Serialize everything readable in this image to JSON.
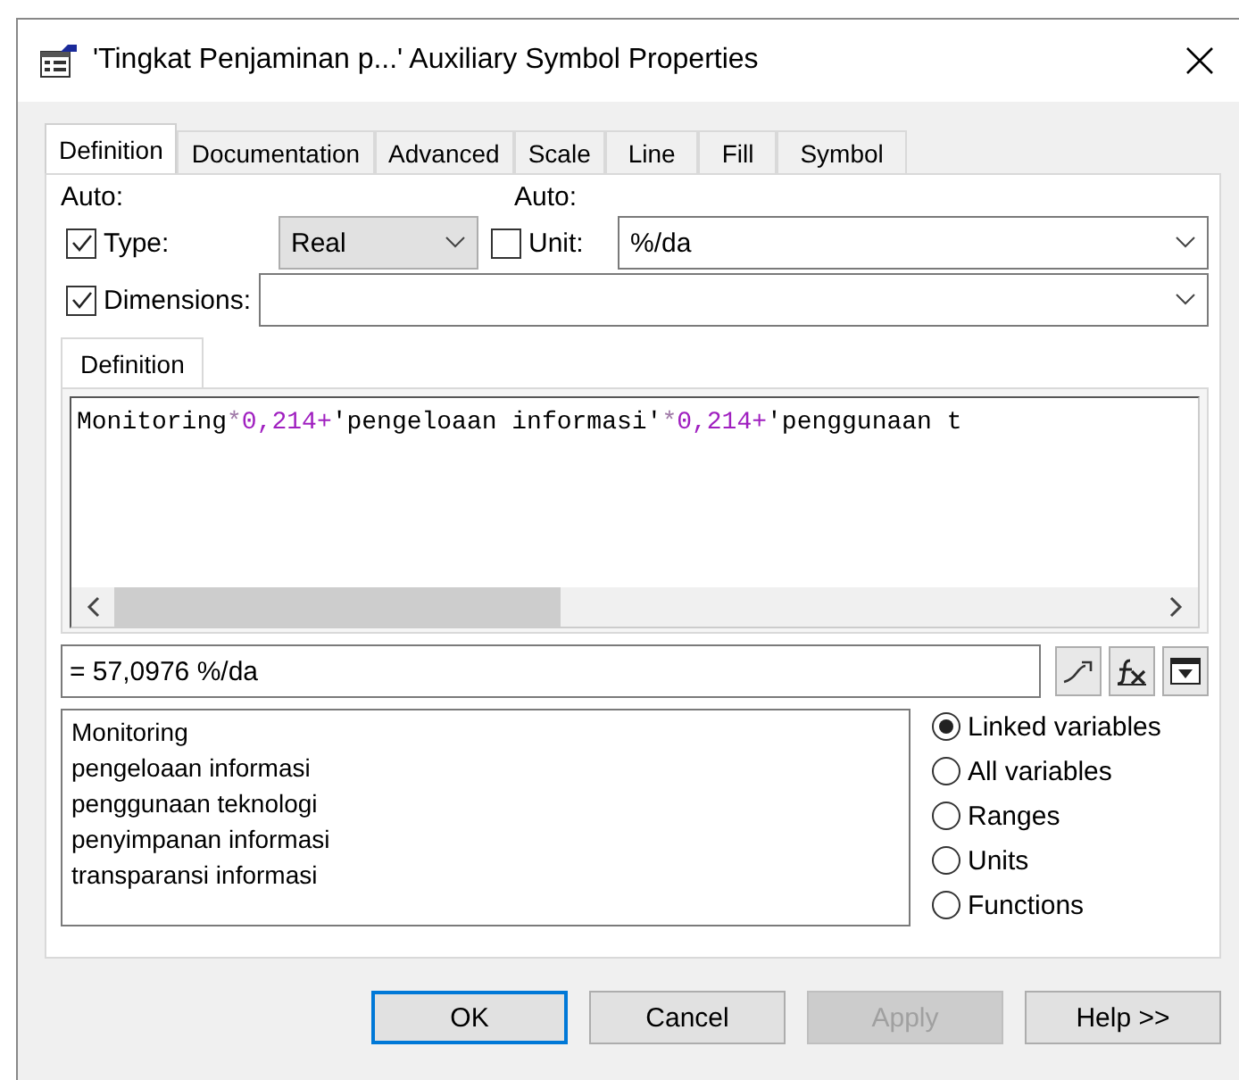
{
  "window": {
    "title": "'Tingkat Penjaminan p...' Auxiliary Symbol Properties"
  },
  "tabs": [
    {
      "label": "Definition",
      "selected": true
    },
    {
      "label": "Documentation",
      "selected": false
    },
    {
      "label": "Advanced",
      "selected": false
    },
    {
      "label": "Scale",
      "selected": false
    },
    {
      "label": "Line",
      "selected": false
    },
    {
      "label": "Fill",
      "selected": false
    },
    {
      "label": "Symbol",
      "selected": false
    }
  ],
  "type_row": {
    "auto_label": "Auto:",
    "label": "Type:",
    "checked": true,
    "value": "Real"
  },
  "unit_row": {
    "auto_label": "Auto:",
    "label": "Unit:",
    "checked": false,
    "value": "%/da"
  },
  "dimensions_row": {
    "label": "Dimensions:",
    "checked": true
  },
  "definition": {
    "tab": "Definition",
    "tokens": [
      {
        "kind": "name",
        "text": "Monitoring"
      },
      {
        "kind": "op",
        "text": "*"
      },
      {
        "kind": "num",
        "text": "0,214"
      },
      {
        "kind": "plus",
        "text": "+"
      },
      {
        "kind": "name",
        "text": "'pengeloaan informasi'"
      },
      {
        "kind": "op",
        "text": "*"
      },
      {
        "kind": "num",
        "text": "0,214"
      },
      {
        "kind": "plus",
        "text": "+"
      },
      {
        "kind": "name",
        "text": "'penggunaan t"
      }
    ]
  },
  "result": {
    "value": "= 57,0976 %/da"
  },
  "variables": [
    "Monitoring",
    "pengeloaan informasi",
    "penggunaan teknologi",
    "penyimpanan informasi",
    "transparansi informasi"
  ],
  "radios": [
    {
      "label": "Linked variables",
      "selected": true
    },
    {
      "label": "All variables",
      "selected": false
    },
    {
      "label": "Ranges",
      "selected": false
    },
    {
      "label": "Units",
      "selected": false
    },
    {
      "label": "Functions",
      "selected": false
    }
  ],
  "buttons": [
    {
      "label": "OK",
      "kind": "default"
    },
    {
      "label": "Cancel",
      "kind": "normal"
    },
    {
      "label": "Apply",
      "kind": "disabled"
    },
    {
      "label": "Help >>",
      "kind": "normal"
    }
  ]
}
